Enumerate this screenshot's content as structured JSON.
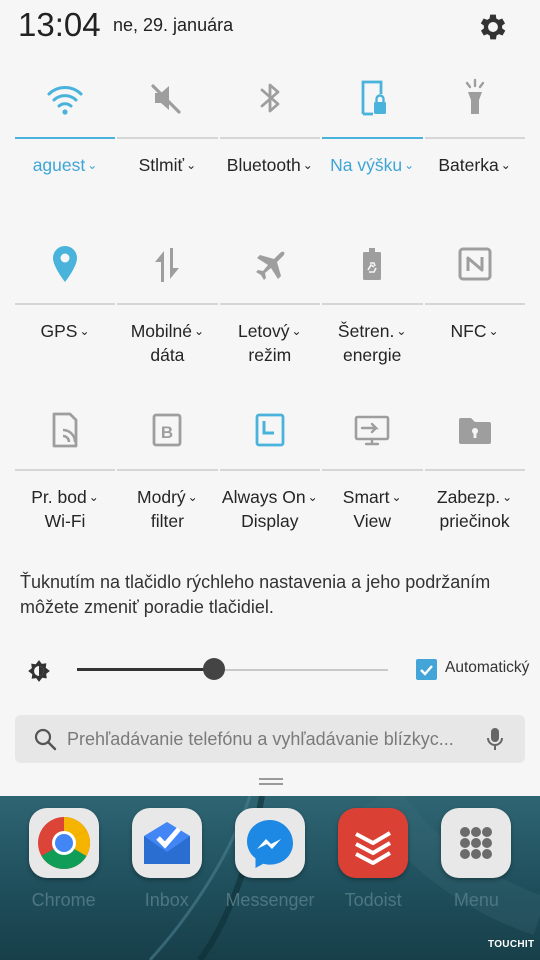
{
  "status": {
    "time": "13:04",
    "date": "ne, 29. januára",
    "settings_icon": "gear-icon"
  },
  "colors": {
    "accent": "#3ea5d6",
    "icon_active": "#49b3dc",
    "icon_inactive": "#9e9e9e",
    "panel_bg": "#f6f6f6"
  },
  "tiles": [
    {
      "label": "aguest",
      "label2": "",
      "icon": "wifi-icon",
      "active": true
    },
    {
      "label": "Stlmiť",
      "label2": "",
      "icon": "mute-icon",
      "active": false
    },
    {
      "label": "Bluetooth",
      "label2": "",
      "icon": "bluetooth-icon",
      "active": false
    },
    {
      "label": "Na výšku",
      "label2": "",
      "icon": "portrait-lock-icon",
      "active": true
    },
    {
      "label": "Baterka",
      "label2": "",
      "icon": "flashlight-icon",
      "active": false
    },
    {
      "label": "GPS",
      "label2": "",
      "icon": "location-icon",
      "active": true
    },
    {
      "label": "Mobilné",
      "label2": "dáta",
      "icon": "mobile-data-icon",
      "active": false
    },
    {
      "label": "Letový",
      "label2": "režim",
      "icon": "airplane-icon",
      "active": false
    },
    {
      "label": "Šetren.",
      "label2": "energie",
      "icon": "battery-saver-icon",
      "active": false
    },
    {
      "label": "NFC",
      "label2": "",
      "icon": "nfc-icon",
      "active": false
    },
    {
      "label": "Pr. bod",
      "label2": "Wi-Fi",
      "icon": "hotspot-icon",
      "active": false
    },
    {
      "label": "Modrý",
      "label2": "filter",
      "icon": "blue-filter-icon",
      "active": false
    },
    {
      "label": "Always On",
      "label2": "Display",
      "icon": "always-on-display-icon",
      "active": true
    },
    {
      "label": "Smart",
      "label2": "View",
      "icon": "smart-view-icon",
      "active": false
    },
    {
      "label": "Zabezp.",
      "label2": "priečinok",
      "icon": "secure-folder-icon",
      "active": false
    }
  ],
  "hint_text": "Ťuknutím na tlačidlo rýchleho nastavenia a jeho podržaním môžete zmeniť poradie tlačidiel.",
  "brightness": {
    "level": 0.44,
    "auto_label": "Automatický",
    "auto_checked": true
  },
  "search": {
    "placeholder": "Prehľadávanie telefónu a vyhľadávanie blízkyc..."
  },
  "dock": [
    {
      "label": "Chrome",
      "icon": "chrome-icon"
    },
    {
      "label": "Inbox",
      "icon": "inbox-icon"
    },
    {
      "label": "Messenger",
      "icon": "messenger-icon"
    },
    {
      "label": "Todoist",
      "icon": "todoist-icon"
    },
    {
      "label": "Menu",
      "icon": "apps-menu-icon"
    }
  ],
  "watermark": "TOUCHIT"
}
